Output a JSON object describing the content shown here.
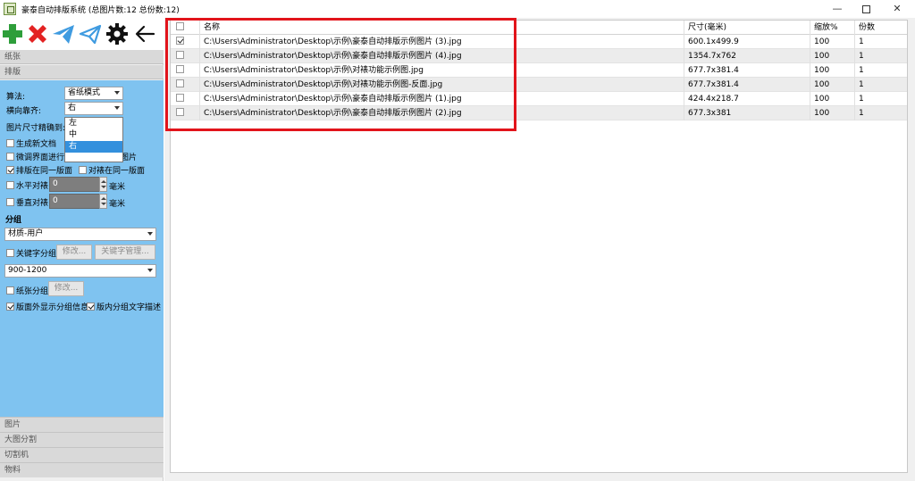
{
  "window": {
    "title": "豪泰自动排版系统 (总图片数:12 总份数:12)",
    "minimize": "—",
    "close": "✕"
  },
  "colors": {
    "panel_blue": "#7fc3f0",
    "add_green": "#2e9e3a",
    "remove_red": "#e32222",
    "send_blue": "#3f9be0",
    "highlight_red": "#e2141b",
    "selection_blue": "#3390dd"
  },
  "toolbar": {
    "icons": [
      "add-icon",
      "delete-icon",
      "send-icon",
      "send-outline-icon",
      "gear-icon",
      "back-arrow-icon"
    ]
  },
  "sections": {
    "paper": "纸张",
    "layout": "排版",
    "image": "图片",
    "big_split": "大图分割",
    "cutter": "切割机",
    "material": "物料"
  },
  "layout_panel": {
    "algorithm_label": "算法:",
    "algorithm_value": "省纸模式",
    "h_align_label": "横向靠齐:",
    "h_align_value": "右",
    "h_align_options": [
      "左",
      "中",
      "右"
    ],
    "size_precision_label": "图片尺寸精确到:",
    "gen_new_doc": "生成新文档",
    "fine_tune_label": "微调界面进行调整",
    "fine_tune_show_label": "微调显示图片",
    "same_side_layout": "排版在同一版面",
    "pair_same_side": "对裱在同一版面",
    "h_pair_label": "水平对裱",
    "h_pair_value": "0",
    "v_pair_label": "垂直对裱",
    "v_pair_value": "0",
    "unit_mm": "毫米"
  },
  "grouping": {
    "title": "分组",
    "material_value": "材质-用户",
    "keyword_group": "关键字分组",
    "modify": "修改...",
    "keyword_manage": "关键字管理...",
    "range_value": "900-1200",
    "paper_group": "纸张分组",
    "modify2": "修改...",
    "show_outside": "版面外显示分组信息",
    "show_inside": "版内分组文字描述"
  },
  "table": {
    "headers": {
      "name": "名称",
      "size": "尺寸(毫米)",
      "scale": "缩放%",
      "count": "份数"
    },
    "rows": [
      {
        "checked": true,
        "name": "C:\\Users\\Administrator\\Desktop\\示例\\豪泰自动排版示例图片 (3).jpg",
        "size": "600.1x499.9",
        "scale": "100",
        "count": "1"
      },
      {
        "checked": false,
        "name": "C:\\Users\\Administrator\\Desktop\\示例\\豪泰自动排版示例图片 (4).jpg",
        "size": "1354.7x762",
        "scale": "100",
        "count": "1"
      },
      {
        "checked": false,
        "name": "C:\\Users\\Administrator\\Desktop\\示例\\对裱功能示例图.jpg",
        "size": "677.7x381.4",
        "scale": "100",
        "count": "1"
      },
      {
        "checked": false,
        "name": "C:\\Users\\Administrator\\Desktop\\示例\\对裱功能示例图-反面.jpg",
        "size": "677.7x381.4",
        "scale": "100",
        "count": "1"
      },
      {
        "checked": false,
        "name": "C:\\Users\\Administrator\\Desktop\\示例\\豪泰自动排版示例图片 (1).jpg",
        "size": "424.4x218.7",
        "scale": "100",
        "count": "1"
      },
      {
        "checked": false,
        "name": "C:\\Users\\Administrator\\Desktop\\示例\\豪泰自动排版示例图片 (2).jpg",
        "size": "677.3x381",
        "scale": "100",
        "count": "1"
      }
    ]
  }
}
